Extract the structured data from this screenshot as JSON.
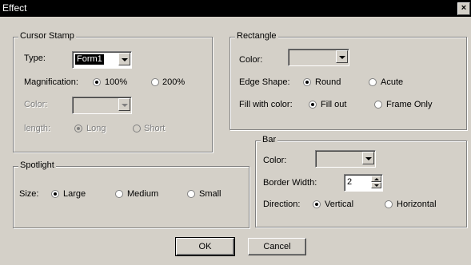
{
  "window": {
    "title": "Effect",
    "close_glyph": "×"
  },
  "cursor_stamp": {
    "legend": "Cursor Stamp",
    "type_label": "Type:",
    "type_value": "Form1",
    "magnification_label": "Magnification:",
    "mag_100": "100%",
    "mag_200": "200%",
    "mag_selected": "100%",
    "color_label": "Color:",
    "length_label": "length:",
    "length_long": "Long",
    "length_short": "Short",
    "length_selected": "Long"
  },
  "rectangle": {
    "legend": "Rectangle",
    "color_label": "Color:",
    "edge_shape_label": "Edge Shape:",
    "edge_round": "Round",
    "edge_acute": "Acute",
    "edge_selected": "Round",
    "fill_label": "Fill with color:",
    "fill_out": "Fill out",
    "frame_only": "Frame Only",
    "fill_selected": "Fill out"
  },
  "spotlight": {
    "legend": "Spotlight",
    "size_label": "Size:",
    "large": "Large",
    "medium": "Medium",
    "small": "Small",
    "size_selected": "Large"
  },
  "bar": {
    "legend": "Bar",
    "color_label": "Color:",
    "border_width_label": "Border Width:",
    "border_width_value": "2",
    "direction_label": "Direction:",
    "vertical": "Vertical",
    "horizontal": "Horizontal",
    "direction_selected": "Vertical"
  },
  "buttons": {
    "ok": "OK",
    "cancel": "Cancel"
  }
}
